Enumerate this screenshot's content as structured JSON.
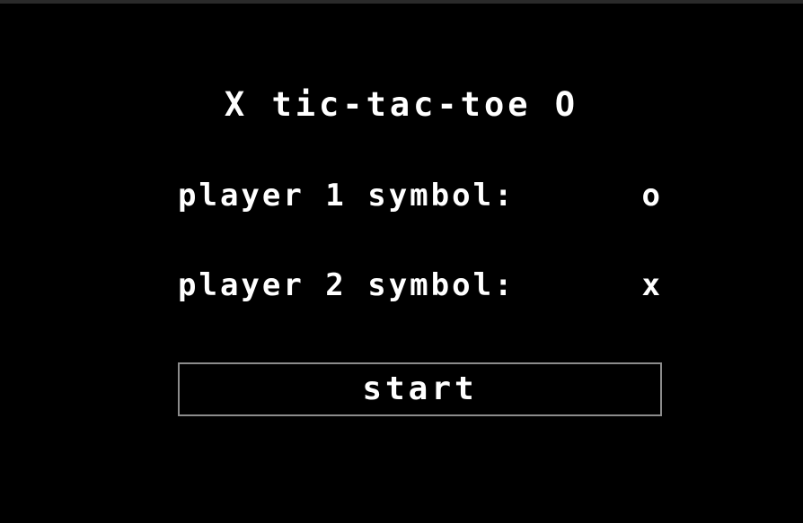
{
  "title": "X tic-tac-toe O",
  "players": [
    {
      "label": "player 1 symbol:",
      "symbol": "o"
    },
    {
      "label": "player 2 symbol:",
      "symbol": "x"
    }
  ],
  "start_button": {
    "label": "start"
  },
  "colors": {
    "background": "#000000",
    "text": "#ffffff",
    "button_border": "#8c8c8c"
  }
}
